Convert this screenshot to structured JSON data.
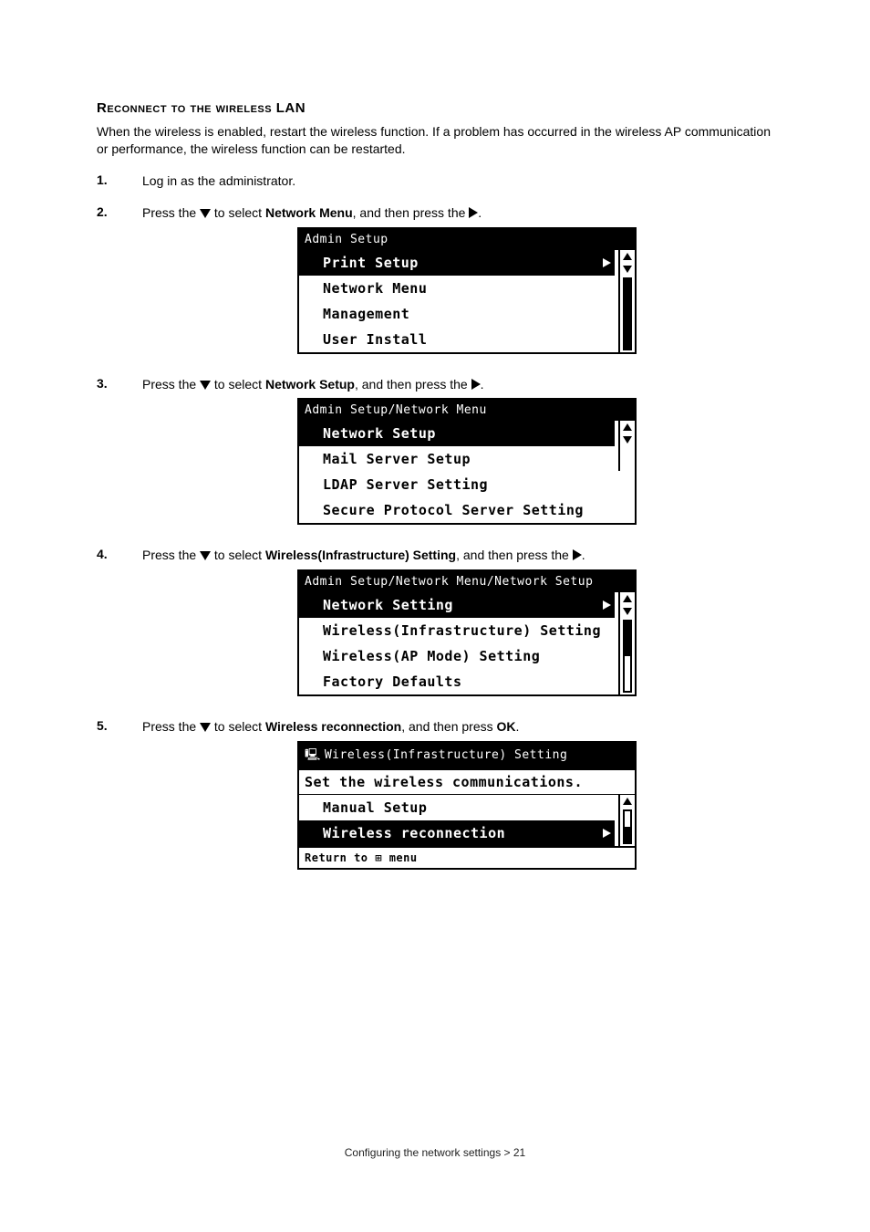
{
  "heading": "Reconnect to the wireless LAN",
  "intro": "When the wireless is enabled, restart the wireless function. If a problem has occurred in the wireless AP communication or performance, the wireless function can be restarted.",
  "steps": [
    {
      "num": "1.",
      "pre": "",
      "post": "Log in as the administrator.",
      "bold": "",
      "panel": null
    },
    {
      "num": "2.",
      "pre": "Press the ",
      "mid": " to select ",
      "bold": "Network Menu",
      "post": ", and then press the ",
      "tail": ".",
      "panel": "p1"
    },
    {
      "num": "3.",
      "pre": "Press the ",
      "mid": " to select ",
      "bold": "Network Setup",
      "post": ", and then press the ",
      "tail": ".",
      "panel": "p2"
    },
    {
      "num": "4.",
      "pre": "Press the ",
      "mid": " to select ",
      "bold": "Wireless(Infrastructure) Setting",
      "post": ", and then press the ",
      "tail": ".",
      "panel": "p3"
    },
    {
      "num": "5.",
      "pre": "Press the ",
      "mid": " to select ",
      "bold": "Wireless reconnection",
      "post": ", and then press ",
      "bold2": "OK",
      "tail": ".",
      "panel": "p4"
    }
  ],
  "panel1": {
    "header": "Admin Setup",
    "items": [
      "Print Setup",
      "Network Menu",
      "Management",
      "User Install"
    ],
    "selectedIndex": 0
  },
  "panel2": {
    "header": "Admin Setup/Network Menu",
    "items": [
      "Network Setup",
      "Mail Server Setup",
      "LDAP Server Setting",
      "Secure Protocol Server Setting"
    ],
    "selectedIndex": 0
  },
  "panel3": {
    "header": "Admin Setup/Network Menu/Network Setup",
    "items": [
      "Network Setting",
      "Wireless(Infrastructure) Setting",
      "Wireless(AP Mode) Setting",
      "Factory Defaults"
    ],
    "selectedIndex": 0
  },
  "panel4": {
    "header": "Wireless(Infrastructure) Setting",
    "subtitle": "Set the wireless communications.",
    "items": [
      "Manual Setup",
      "Wireless reconnection"
    ],
    "selectedIndex": 1,
    "footer": "Return to ⊞ menu"
  },
  "footer": "Configuring the network settings > 21"
}
